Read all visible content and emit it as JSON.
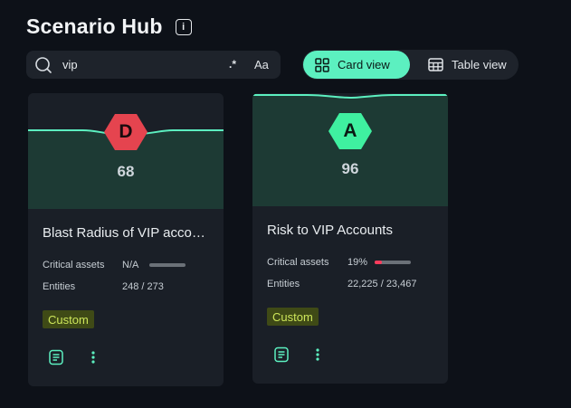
{
  "header": {
    "title": "Scenario Hub",
    "info_icon": "info-icon"
  },
  "search": {
    "value": "vip",
    "regex_label": ".*",
    "case_label": "Aa"
  },
  "view_toggle": {
    "card_label": "Card view",
    "table_label": "Table view",
    "active": "card"
  },
  "colors": {
    "accent": "#5cf0c0",
    "danger": "#e5444f",
    "tag_bg": "#3f4a16",
    "tag_fg": "#cde65a"
  },
  "cards": [
    {
      "grade": "D",
      "grade_color": "#e5444f",
      "score": "68",
      "name": "Blast Radius of VIP accounts",
      "critical_assets_label": "Critical assets",
      "critical_assets_value": "N/A",
      "critical_assets_fraction": 0,
      "entities_label": "Entities",
      "entities_value": "248 / 273",
      "tag": "Custom"
    },
    {
      "grade": "A",
      "grade_color": "#3ff0a0",
      "score": "96",
      "name": "Risk to VIP Accounts",
      "critical_assets_label": "Critical assets",
      "critical_assets_value": "19%",
      "critical_assets_fraction": 0.19,
      "entities_label": "Entities",
      "entities_value": "22,225 / 23,467",
      "tag": "Custom"
    }
  ]
}
